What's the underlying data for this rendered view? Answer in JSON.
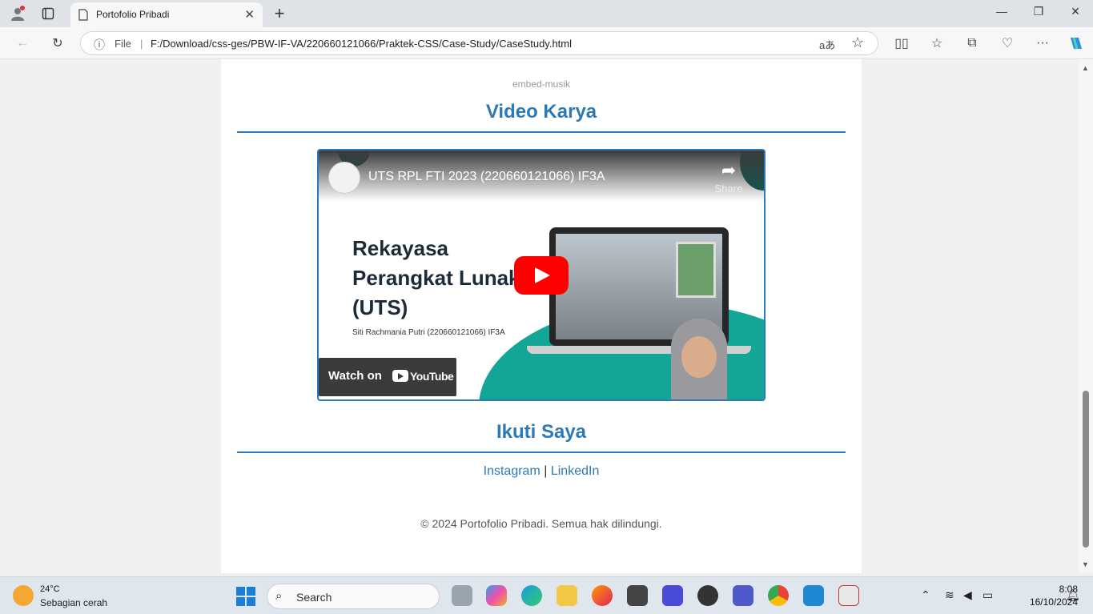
{
  "browser": {
    "tab_title": "Portofolio Pribadi",
    "address_file_label": "File",
    "address_url": "F:/Download/css-ges/PBW-IF-VA/220660121066/Praktek-CSS/Case-Study/CaseStudy.html"
  },
  "page": {
    "embed_label": "embed-musik",
    "video_section_title": "Video Karya",
    "video": {
      "title": "UTS RPL FTI 2023 (220660121066) IF3A",
      "share_label": "Share",
      "heading_line1": "Rekayasa",
      "heading_line2": "Perangkat Lunak",
      "heading_line3": "(UTS)",
      "subtitle": "Siti Rachmania Putri (220660121066) IF3A",
      "watch_on": "Watch on",
      "youtube": "YouTube"
    },
    "follow_section_title": "Ikuti Saya",
    "links": {
      "instagram": "Instagram",
      "separator": "|",
      "linkedin": "LinkedIn"
    },
    "footer": "© 2024 Portofolio Pribadi. Semua hak dilindungi."
  },
  "taskbar": {
    "weather_temp": "24°C",
    "weather_desc": "Sebagian cerah",
    "search_label": "Search",
    "time": "8:08",
    "date": "16/10/2024"
  },
  "colors": {
    "accent": "#2c7ab5",
    "youtube_red": "#ff0000",
    "teal": "#13a596"
  }
}
